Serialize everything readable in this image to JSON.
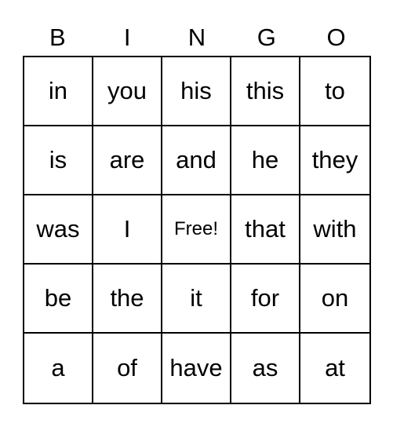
{
  "header": [
    "B",
    "I",
    "N",
    "G",
    "O"
  ],
  "rows": [
    [
      "in",
      "you",
      "his",
      "this",
      "to"
    ],
    [
      "is",
      "are",
      "and",
      "he",
      "they"
    ],
    [
      "was",
      "I",
      "Free!",
      "that",
      "with"
    ],
    [
      "be",
      "the",
      "it",
      "for",
      "on"
    ],
    [
      "a",
      "of",
      "have",
      "as",
      "at"
    ]
  ]
}
